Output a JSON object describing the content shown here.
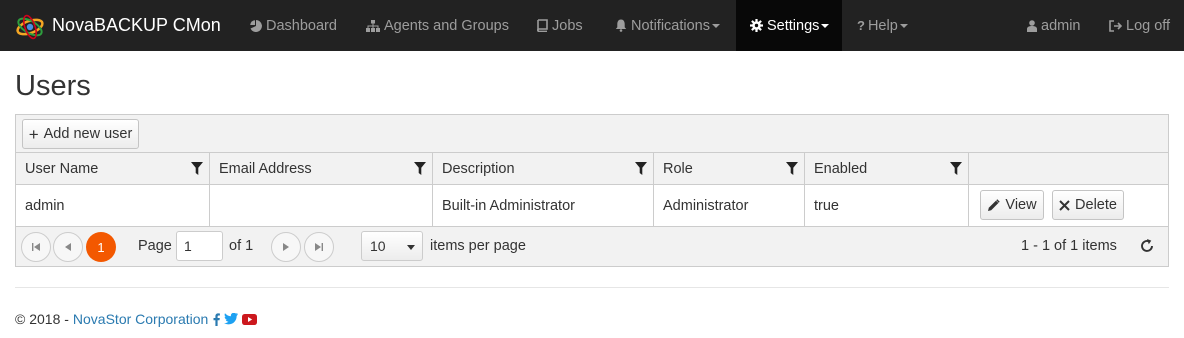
{
  "app": {
    "title": "NovaBACKUP CMon"
  },
  "nav": {
    "dashboard": "Dashboard",
    "agents_groups": "Agents and Groups",
    "jobs": "Jobs",
    "notifications": "Notifications",
    "settings": "Settings",
    "help": "Help",
    "user": "admin",
    "logoff": "Log off"
  },
  "page": {
    "title": "Users"
  },
  "toolbar": {
    "add_label": "Add new user"
  },
  "grid": {
    "columns": [
      "User Name",
      "Email Address",
      "Description",
      "Role",
      "Enabled"
    ],
    "rows": [
      {
        "user_name": "admin",
        "email": "",
        "description": "Built-in Administrator",
        "role": "Administrator",
        "enabled": "true"
      }
    ],
    "actions": {
      "view": "View",
      "delete": "Delete"
    }
  },
  "pager": {
    "current_page": "1",
    "page_label": "Page",
    "page_value": "1",
    "of_label": "of 1",
    "page_size": "10",
    "per_page_label": "items per page",
    "summary": "1 - 1 of 1 items"
  },
  "footer": {
    "copyright": "© 2018 -",
    "company": "NovaStor Corporation"
  },
  "colors": {
    "navbar_bg": "#222222",
    "active_nav_bg": "#080808",
    "accent_orange": "#f35800",
    "link_blue": "#2a7ab0",
    "twitter_blue": "#1da1f2",
    "youtube_red": "#cc181e"
  },
  "icons": {
    "brand": "novabackup-logo-icon",
    "dashboard": "pie-chart-icon",
    "agents": "sitemap-icon",
    "jobs": "book-icon",
    "notifications": "bell-icon",
    "settings": "gear-icon",
    "help": "question-icon",
    "user": "user-icon",
    "logoff": "sign-out-icon",
    "filter": "filter-icon",
    "view": "pencil-icon",
    "delete": "close-icon",
    "refresh": "refresh-icon"
  }
}
